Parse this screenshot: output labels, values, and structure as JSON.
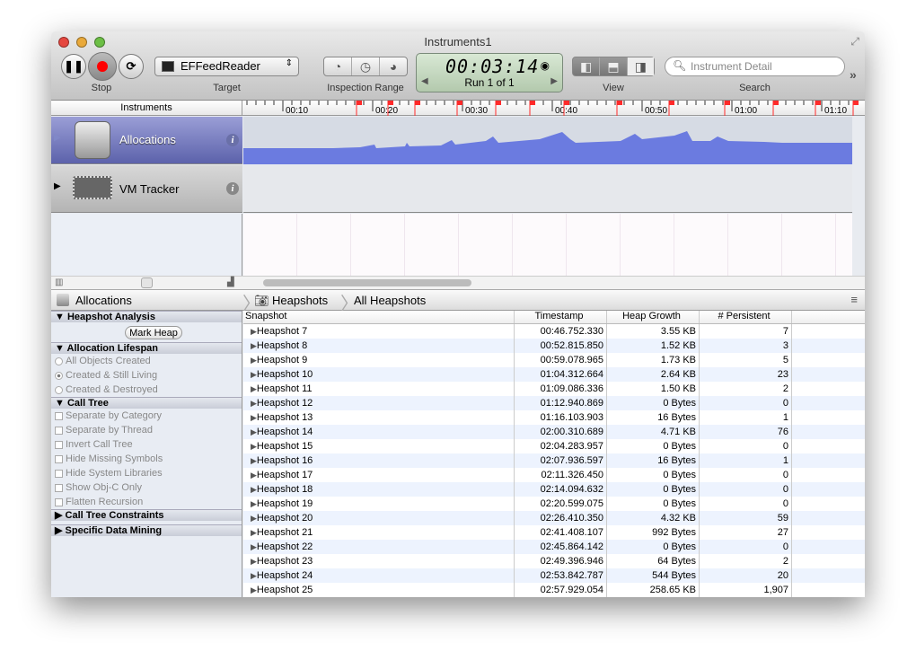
{
  "window": {
    "title": "Instruments1"
  },
  "toolbar": {
    "stop_label": "Stop",
    "target_label": "Target",
    "target_value": "EFFeedReader",
    "inspection_label": "Inspection Range",
    "time": "00:03:14",
    "run": "Run 1 of 1",
    "view_label": "View",
    "search_label": "Search",
    "search_placeholder": "Instrument Detail"
  },
  "ruler": {
    "header": "Instruments",
    "ticks": [
      "00:10",
      "00:20",
      "00:30",
      "00:40",
      "00:50",
      "01:00",
      "01:10"
    ]
  },
  "instruments": [
    {
      "name": "Allocations",
      "selected": true
    },
    {
      "name": "VM Tracker",
      "selected": false
    }
  ],
  "colors": {
    "graph": "#6b7be0",
    "selected_track": "#6a70b8",
    "marker": "#ff2a2a"
  },
  "nav": {
    "instrument": "Allocations",
    "crumb1": "Heapshots",
    "crumb2": "All Heapshots"
  },
  "sidebar": {
    "heapshot_analysis": "Heapshot Analysis",
    "mark_heap": "Mark Heap",
    "lifespan": "Allocation Lifespan",
    "lifespan_options": [
      "All Objects Created",
      "Created & Still Living",
      "Created & Destroyed"
    ],
    "lifespan_selected": 1,
    "call_tree": "Call Tree",
    "call_tree_options": [
      "Separate by Category",
      "Separate by Thread",
      "Invert Call Tree",
      "Hide Missing Symbols",
      "Hide System Libraries",
      "Show Obj-C Only",
      "Flatten Recursion"
    ],
    "constraints": "Call Tree Constraints",
    "data_mining": "Specific Data Mining"
  },
  "table": {
    "columns": [
      "Snapshot",
      "Timestamp",
      "Heap Growth",
      "# Persistent"
    ],
    "rows": [
      [
        "Heapshot 7",
        "00:46.752.330",
        "3.55 KB",
        "7"
      ],
      [
        "Heapshot 8",
        "00:52.815.850",
        "1.52 KB",
        "3"
      ],
      [
        "Heapshot 9",
        "00:59.078.965",
        "1.73 KB",
        "5"
      ],
      [
        "Heapshot 10",
        "01:04.312.664",
        "2.64 KB",
        "23"
      ],
      [
        "Heapshot 11",
        "01:09.086.336",
        "1.50 KB",
        "2"
      ],
      [
        "Heapshot 12",
        "01:12.940.869",
        "0 Bytes",
        "0"
      ],
      [
        "Heapshot 13",
        "01:16.103.903",
        "16 Bytes",
        "1"
      ],
      [
        "Heapshot 14",
        "02:00.310.689",
        "4.71 KB",
        "76"
      ],
      [
        "Heapshot 15",
        "02:04.283.957",
        "0 Bytes",
        "0"
      ],
      [
        "Heapshot 16",
        "02:07.936.597",
        "16 Bytes",
        "1"
      ],
      [
        "Heapshot 17",
        "02:11.326.450",
        "0 Bytes",
        "0"
      ],
      [
        "Heapshot 18",
        "02:14.094.632",
        "0 Bytes",
        "0"
      ],
      [
        "Heapshot 19",
        "02:20.599.075",
        "0 Bytes",
        "0"
      ],
      [
        "Heapshot 20",
        "02:26.410.350",
        "4.32 KB",
        "59"
      ],
      [
        "Heapshot 21",
        "02:41.408.107",
        "992 Bytes",
        "27"
      ],
      [
        "Heapshot 22",
        "02:45.864.142",
        "0 Bytes",
        "0"
      ],
      [
        "Heapshot 23",
        "02:49.396.946",
        "64 Bytes",
        "2"
      ],
      [
        "Heapshot 24",
        "02:53.842.787",
        "544 Bytes",
        "20"
      ],
      [
        "Heapshot 25",
        "02:57.929.054",
        "258.65 KB",
        "1,907"
      ]
    ]
  }
}
